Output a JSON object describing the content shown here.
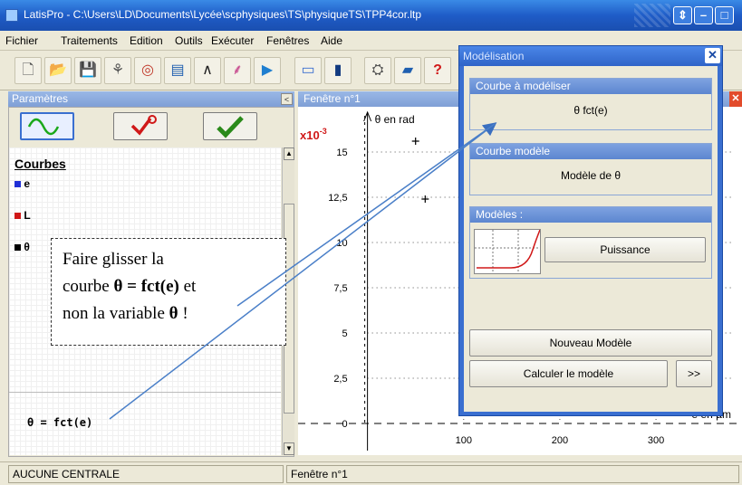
{
  "window": {
    "title": "LatisPro - C:\\Users\\LD\\Documents\\Lycée\\scphysiques\\TS\\physiqueTS\\TPP4cor.ltp",
    "buttons": [
      "⇕",
      "–",
      "□",
      "✕"
    ]
  },
  "menu": [
    "Fichier",
    "Traitements",
    "Edition",
    "Outils",
    "Exécuter",
    "Fenêtres",
    "Aide"
  ],
  "toolbar": {
    "icons": [
      "new-doc-icon",
      "open-folder-icon",
      "save-icon",
      "tree-icon",
      "chart-icon",
      "sheet-icon",
      "curve-icon",
      "modelisation-icon",
      "play-icon",
      "print-icon",
      "calc-icon",
      "tools-icon",
      "book-icon",
      "help-icon"
    ],
    "glyphs": [
      "🗋",
      "📂",
      "💾",
      "⚘",
      "◎",
      "▤",
      "∧",
      "⸙",
      "▶",
      "▭",
      "▮",
      "⛭",
      "▰",
      "?"
    ]
  },
  "params": {
    "title": "Paramètres",
    "collapse": "<",
    "curves_heading": "Courbes",
    "curves": [
      {
        "name": "e",
        "color": "#1f2fd6"
      },
      {
        "name": "L",
        "color": "#d01818"
      },
      {
        "name": "θ",
        "color": "#000000"
      }
    ],
    "formula": "θ = fct(e)"
  },
  "callout": {
    "line1": "Faire glisser la",
    "line2_a": "courbe ",
    "line2_b": "θ = fct(e)",
    "line2_c": " et",
    "line3": "non la variable ",
    "line3_b": "θ",
    "line3_c": " !"
  },
  "graph_window": {
    "title": "Fenêtre n°1",
    "close": "✕",
    "multiplier": "x10-3",
    "y_axis_label": "θ en rad",
    "x_axis_label": "e en µm",
    "y_ticks": [
      "0",
      "2,5",
      "5",
      "7,5",
      "10",
      "12,5",
      "15"
    ],
    "x_ticks": [
      "100",
      "200",
      "300"
    ]
  },
  "chart_data": {
    "type": "scatter",
    "xlabel": "e en µm",
    "ylabel": "θ en rad",
    "y_multiplier": "x10-3",
    "ylim": [
      0,
      17
    ],
    "xlim": [
      -10,
      380
    ],
    "points": [
      {
        "x": 50,
        "y": 15.6
      },
      {
        "x": 60,
        "y": 12.4
      }
    ]
  },
  "dialog": {
    "title": "Modélisation",
    "close": "✕",
    "curve_to_model_label": "Courbe à modéliser",
    "curve_to_model_value": "θ  fct(e)",
    "model_curve_label": "Courbe modèle",
    "model_curve_value": "Modèle de θ",
    "models_label": "Modèles :",
    "model_button": "Puissance",
    "new_model_button": "Nouveau Modèle",
    "compute_button": "Calculer le modèle",
    "more_button": ">>"
  },
  "status": {
    "left": "AUCUNE CENTRALE",
    "right": "Fenêtre n°1"
  }
}
